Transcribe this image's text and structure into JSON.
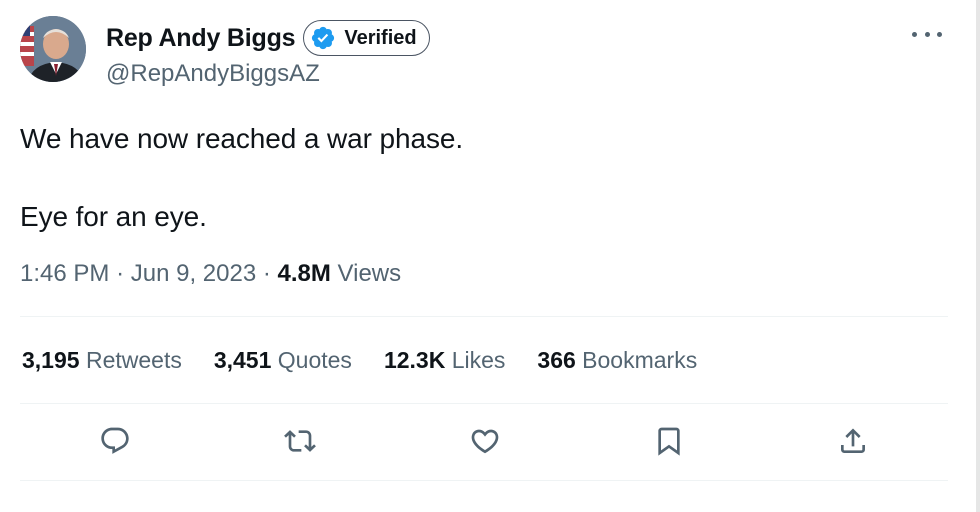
{
  "author": {
    "display_name": "Rep Andy Biggs",
    "verified_label": "Verified",
    "handle": "@RepAndyBiggsAZ"
  },
  "tweet": {
    "lines": [
      "We have now reached a war phase.",
      "Eye for an eye."
    ],
    "time": "1:46 PM",
    "separator": "·",
    "date": "Jun 9, 2023",
    "views_count": "4.8M",
    "views_label": "Views"
  },
  "stats": [
    {
      "count": "3,195",
      "label": "Retweets"
    },
    {
      "count": "3,451",
      "label": "Quotes"
    },
    {
      "count": "12.3K",
      "label": "Likes"
    },
    {
      "count": "366",
      "label": "Bookmarks"
    }
  ],
  "actions": [
    {
      "icon": "reply-icon"
    },
    {
      "icon": "retweet-icon"
    },
    {
      "icon": "like-icon"
    },
    {
      "icon": "bookmark-icon"
    },
    {
      "icon": "share-icon"
    }
  ],
  "colors": {
    "text": "#0f1419",
    "secondary": "#536471",
    "verified_blue": "#1d9bf0",
    "divider": "#eff3f4"
  }
}
